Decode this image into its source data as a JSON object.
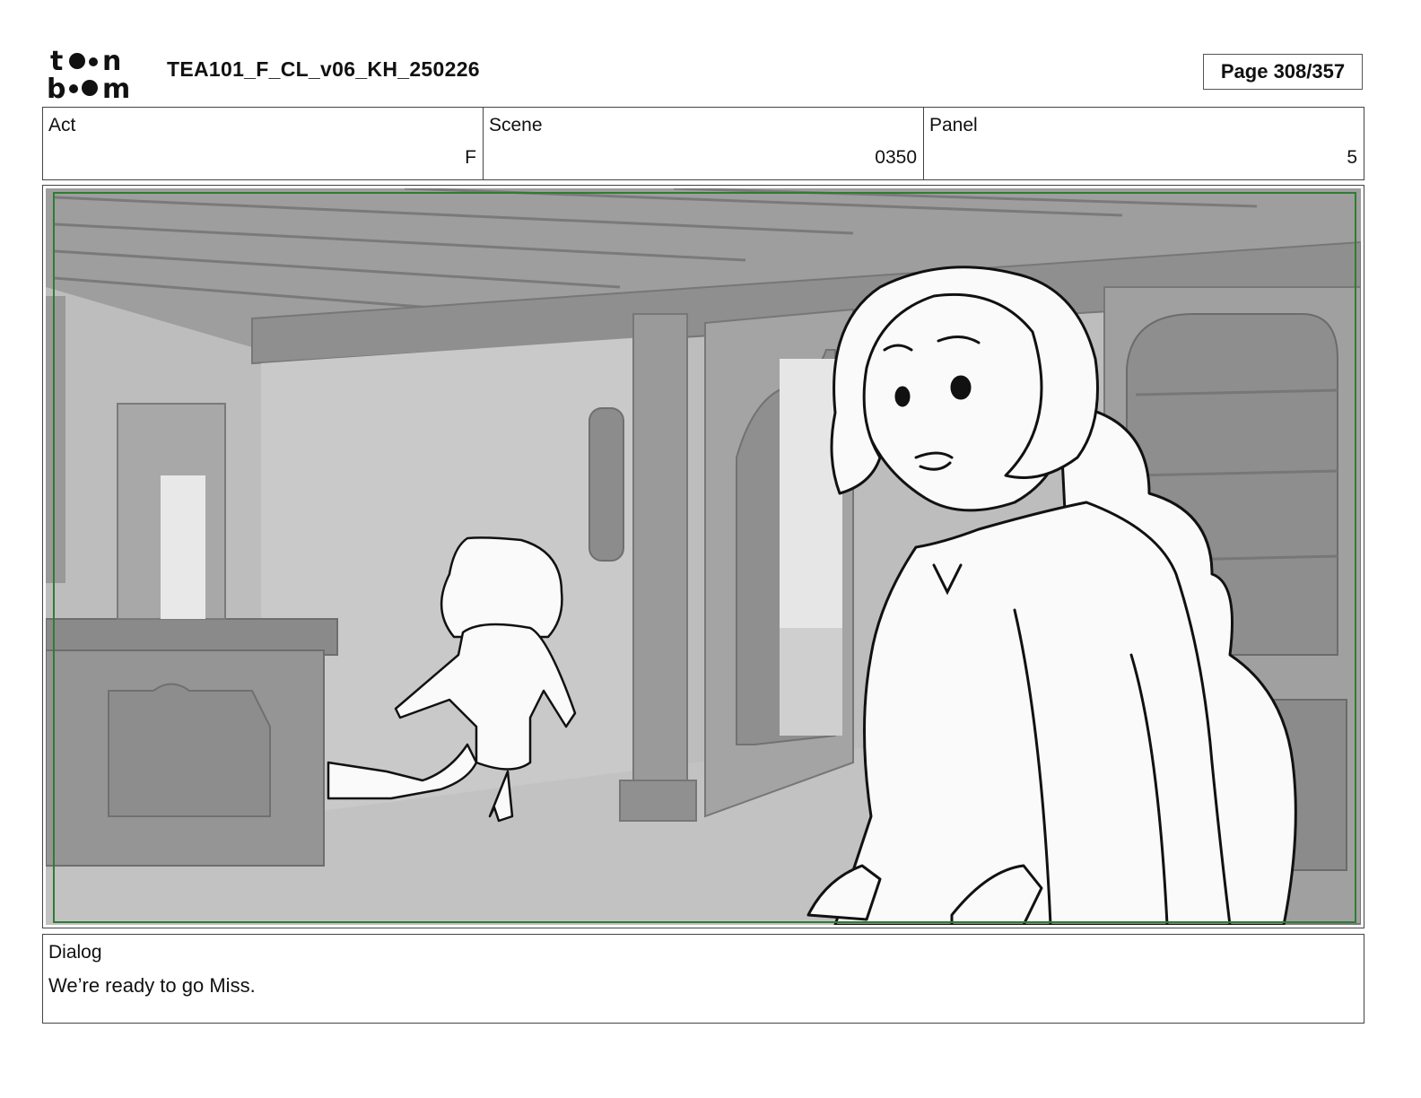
{
  "header": {
    "logo_text": "toon boom",
    "document_title": "TEA101_F_CL_v06_KH_250226",
    "page_indicator": "Page 308/357"
  },
  "info": {
    "act": {
      "label": "Act",
      "value": "F"
    },
    "scene": {
      "label": "Scene",
      "value": "0350"
    },
    "panel": {
      "label": "Panel",
      "value": "5"
    }
  },
  "dialog": {
    "label": "Dialog",
    "text": "We’re ready to go Miss."
  },
  "colors": {
    "safe_frame": "#2e7d32",
    "background_grey": "#b9b9b9"
  }
}
